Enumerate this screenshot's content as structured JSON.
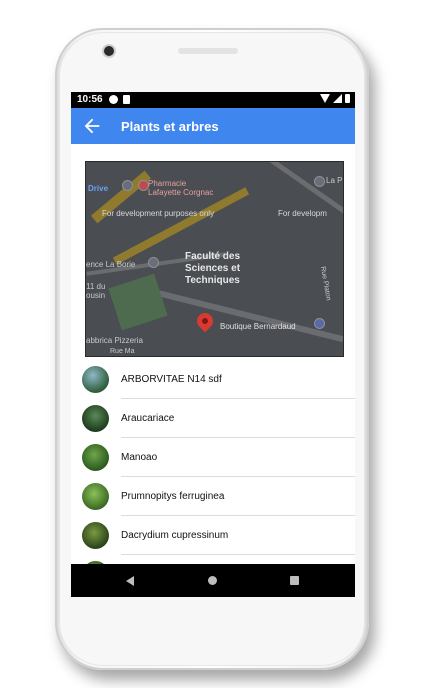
{
  "status_bar": {
    "time": "10:56"
  },
  "app_bar": {
    "title": "Plants et arbres",
    "back_icon": "arrow-left-icon"
  },
  "map": {
    "dev_watermark": "For development purposes only",
    "dev_watermark_right": "For developm",
    "place_title": "Faculté des\nSciences et\nTechniques",
    "labels": {
      "pharmacy": "Pharmacie\nLafayette Corgnac",
      "drive": "Drive",
      "la_borie": "ence La Borie",
      "du_ousin": "11 du\nousin",
      "pizzeria": "abbrica Pizzeria",
      "boutique": "Boutique Bernardaud",
      "rue_platon": "Rue Platon",
      "la_p": "La P",
      "rue_marc": "Rue Ma"
    }
  },
  "plants": [
    {
      "name": "ARBORVITAE N14 sdf",
      "thumb_color": "#5a8fa8"
    },
    {
      "name": "Araucariace",
      "thumb_color": "#2f5a2e"
    },
    {
      "name": "Manoao",
      "thumb_color": "#3d7a2e"
    },
    {
      "name": "Prumnopitys ferruginea",
      "thumb_color": "#4f8e35"
    },
    {
      "name": "Dacrydium cupressinum",
      "thumb_color": "#3a5e24"
    }
  ],
  "nav_bar": {
    "back": "nav-back-icon",
    "home": "nav-home-icon",
    "recents": "nav-recents-icon"
  }
}
